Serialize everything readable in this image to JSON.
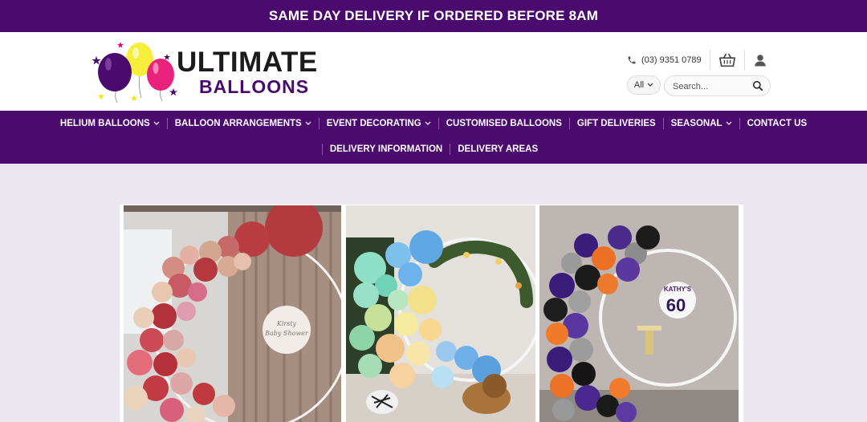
{
  "announcement": "SAME DAY DELIVERY IF ORDERED BEFORE 8AM",
  "logo": {
    "line1": "ULTIMATE",
    "line2": "BALLOONS"
  },
  "header": {
    "phone": "(03) 9351 0789",
    "phone_icon": "phone-icon",
    "cart_icon": "basket-icon",
    "account_icon": "user-icon",
    "category_select": "All",
    "search_placeholder": "Search...",
    "search_icon": "search-icon"
  },
  "nav": {
    "row1": [
      {
        "label": "HELIUM BALLOONS",
        "dropdown": true
      },
      {
        "label": "BALLOON ARRANGEMENTS",
        "dropdown": true
      },
      {
        "label": "EVENT DECORATING",
        "dropdown": true
      },
      {
        "label": "CUSTOMISED BALLOONS",
        "dropdown": false
      },
      {
        "label": "GIFT DELIVERIES",
        "dropdown": false
      },
      {
        "label": "SEASONAL",
        "dropdown": true
      },
      {
        "label": "CONTACT US",
        "dropdown": false
      }
    ],
    "row2": [
      {
        "label": "DELIVERY INFORMATION",
        "dropdown": false
      },
      {
        "label": "DELIVERY AREAS",
        "dropdown": false
      }
    ]
  },
  "gallery": {
    "photo1_sign": "Kirsty Baby Shower",
    "photo3_sign_name": "KATHY'S",
    "photo3_sign_number": "60"
  },
  "colors": {
    "brand_purple": "#4a0a6e",
    "page_background": "#ebe6f0"
  }
}
